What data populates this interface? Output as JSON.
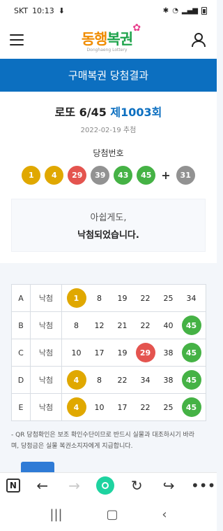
{
  "status": {
    "carrier": "SKT",
    "time": "10:13"
  },
  "header": {
    "logo_main_1": "동행",
    "logo_main_2": "복권",
    "logo_sub": "Donghaeng Lottery"
  },
  "title_bar": {
    "title": "구매복권 당첨결과"
  },
  "draw": {
    "game": "로또 6/45 ",
    "round": "제1003회",
    "date": "2022-02-19 추첨",
    "winning_label": "당첨번호",
    "numbers": [
      1,
      4,
      29,
      39,
      43,
      45
    ],
    "bonus": 31,
    "ball_colors": [
      "yellow",
      "yellow",
      "red",
      "gray",
      "green",
      "green"
    ],
    "bonus_color": "gray"
  },
  "message": {
    "line1": "아쉽게도,",
    "line2": "낙첨되었습니다."
  },
  "ticket": {
    "rows": [
      {
        "letter": "A",
        "status": "낙첨",
        "numbers": [
          "1",
          "8",
          "19",
          "22",
          "25",
          "34"
        ]
      },
      {
        "letter": "B",
        "status": "낙첨",
        "numbers": [
          "8",
          "12",
          "21",
          "22",
          "40",
          "45"
        ]
      },
      {
        "letter": "C",
        "status": "낙첨",
        "numbers": [
          "10",
          "17",
          "19",
          "29",
          "38",
          "45"
        ]
      },
      {
        "letter": "D",
        "status": "낙첨",
        "numbers": [
          "4",
          "8",
          "22",
          "34",
          "38",
          "45"
        ]
      },
      {
        "letter": "E",
        "status": "낙첨",
        "numbers": [
          "4",
          "10",
          "17",
          "22",
          "25",
          "45"
        ]
      }
    ]
  },
  "note": {
    "line1": "- QR 당첨확인은 보조 확인수단이므로 반드시 실물과 대조하시기 바라",
    "line2": "   며, 당첨금은 실물 복권소지자에게 지급합니다."
  },
  "colors": {
    "brand_blue": "#0c6fc0",
    "yellow": "#e0a800",
    "red": "#e4544f",
    "gray": "#929292",
    "green": "#45b245"
  },
  "browser": {
    "tab_label": "N"
  }
}
